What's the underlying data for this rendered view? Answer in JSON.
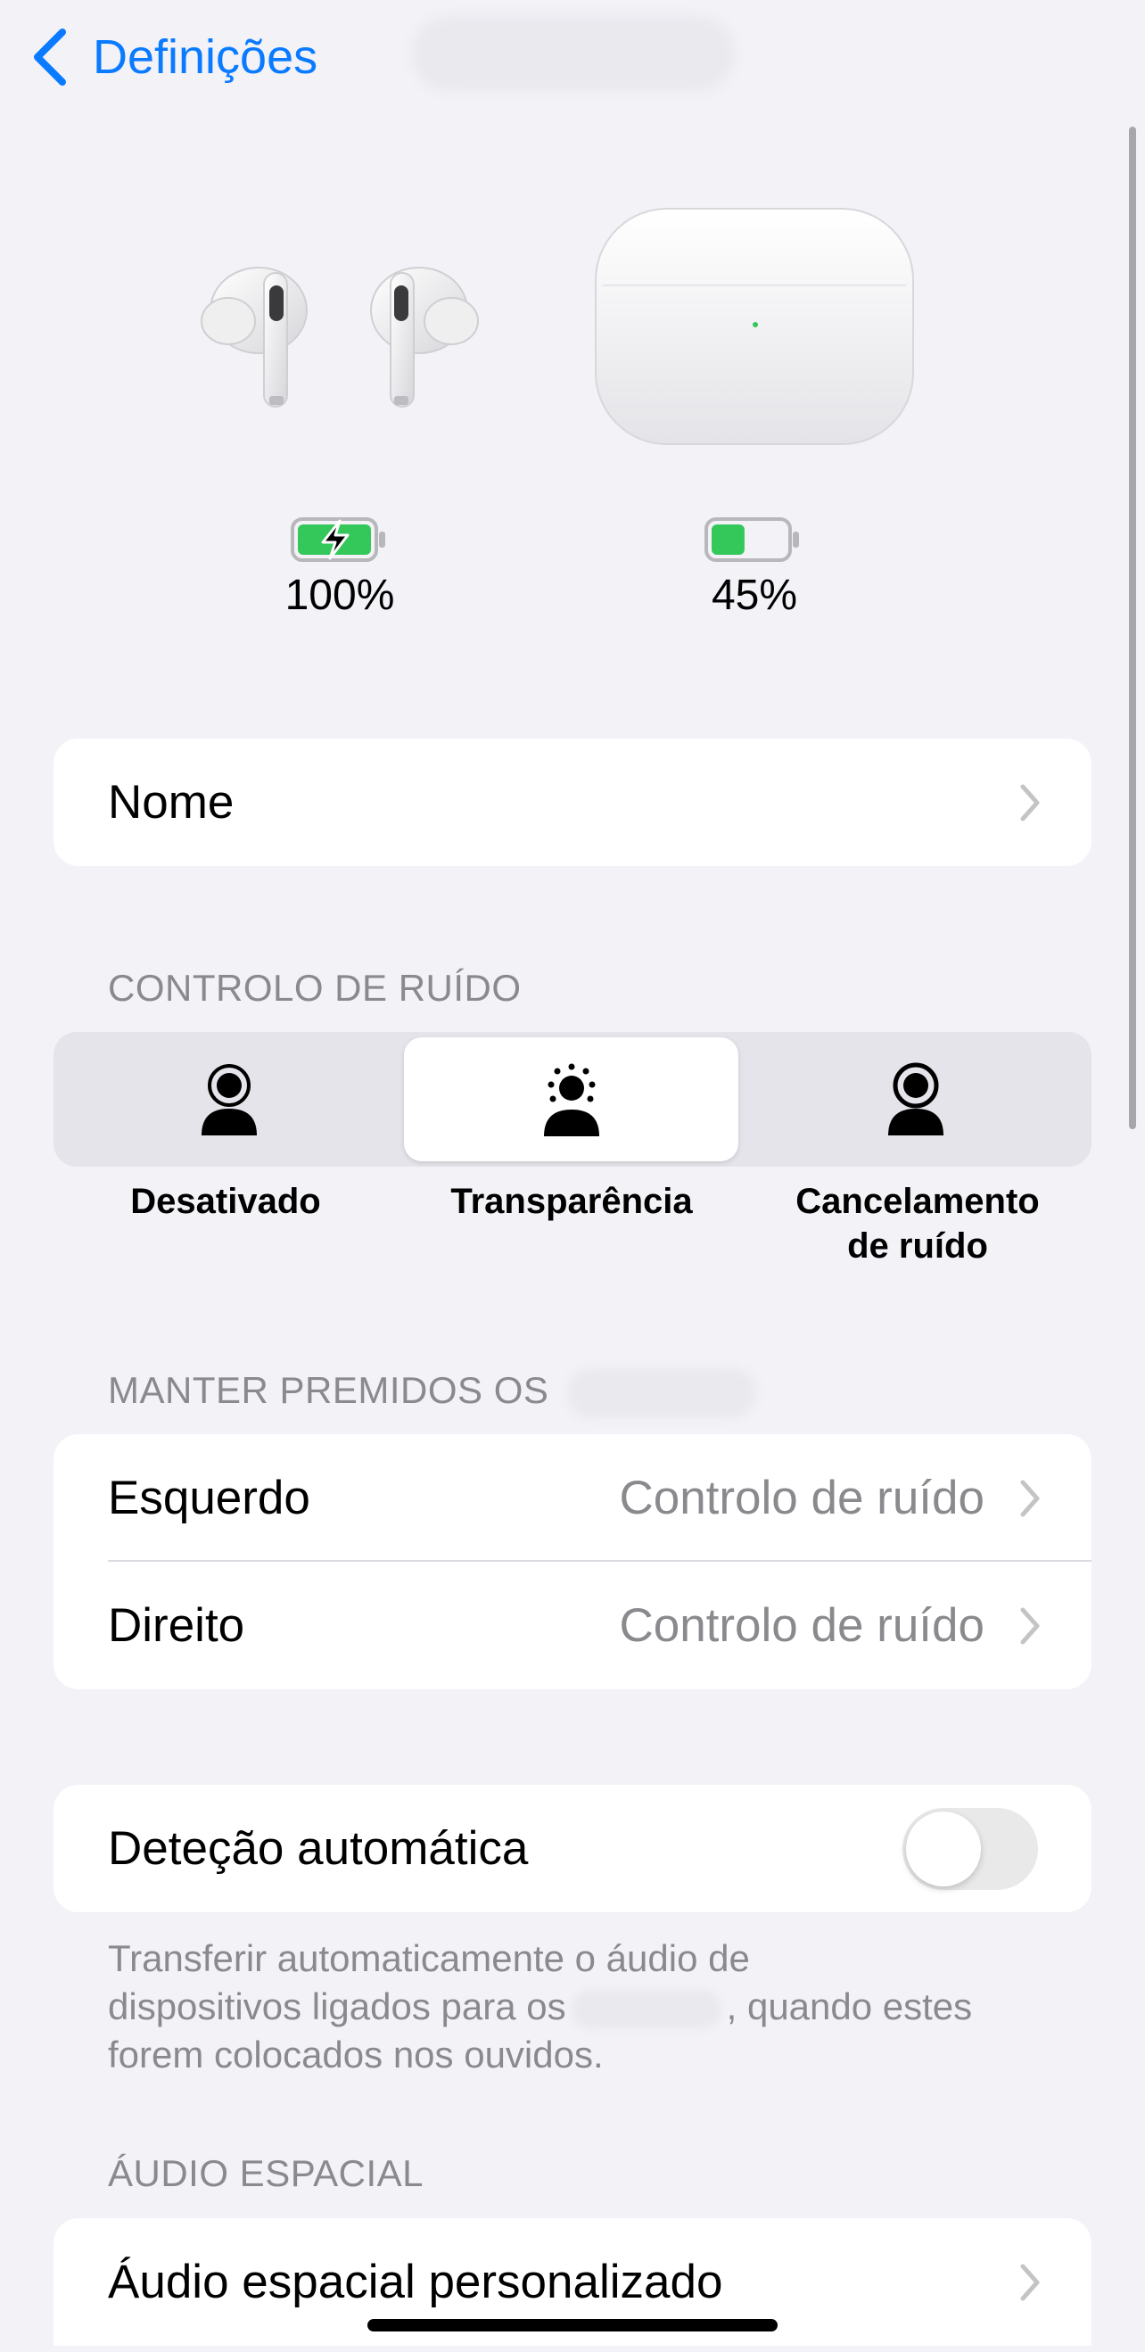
{
  "nav": {
    "back_label": "Definições"
  },
  "devices": {
    "buds": {
      "battery": "100%",
      "battery_level": 1.0,
      "charging": true
    },
    "case": {
      "battery": "45%",
      "battery_level": 0.45,
      "charging": false
    }
  },
  "name_row": {
    "label": "Nome"
  },
  "noise_control": {
    "header": "CONTROLO DE RUÍDO",
    "options": [
      {
        "label": "Desativado",
        "icon": "person-off-icon",
        "selected": false
      },
      {
        "label": "Transparência",
        "icon": "person-transparency-icon",
        "selected": true
      },
      {
        "label_line1": "Cancelamento",
        "label_line2": "de ruído",
        "icon": "person-noise-cancel-icon",
        "selected": false
      }
    ]
  },
  "press_hold": {
    "header": "MANTER PREMIDOS OS",
    "rows": [
      {
        "label": "Esquerdo",
        "value": "Controlo de ruído"
      },
      {
        "label": "Direito",
        "value": "Controlo de ruído"
      }
    ]
  },
  "auto_detect": {
    "label": "Deteção automática",
    "enabled": false,
    "footer_line1": "Transferir automaticamente o áudio de",
    "footer_line2a": "dispositivos ligados para os",
    "footer_line2b": ", quando estes",
    "footer_line3": "forem colocados nos ouvidos."
  },
  "spatial": {
    "header": "ÁUDIO ESPACIAL",
    "row_label": "Áudio espacial personalizado"
  },
  "colors": {
    "accent": "#0a7aff",
    "battery_green": "#34c759",
    "background": "#f2f2f7"
  }
}
